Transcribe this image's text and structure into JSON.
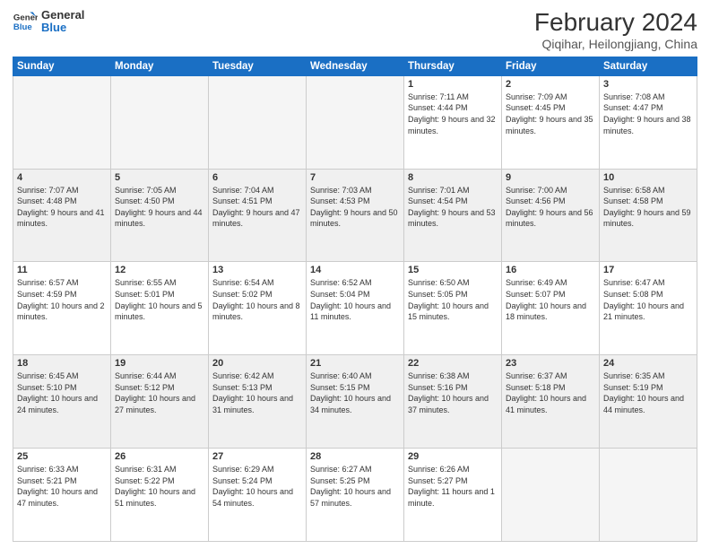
{
  "logo": {
    "line1": "General",
    "line2": "Blue"
  },
  "title": "February 2024",
  "location": "Qiqihar, Heilongjiang, China",
  "days_of_week": [
    "Sunday",
    "Monday",
    "Tuesday",
    "Wednesday",
    "Thursday",
    "Friday",
    "Saturday"
  ],
  "weeks": [
    [
      {
        "num": "",
        "empty": true
      },
      {
        "num": "",
        "empty": true
      },
      {
        "num": "",
        "empty": true
      },
      {
        "num": "",
        "empty": true
      },
      {
        "num": "1",
        "sunrise": "7:11 AM",
        "sunset": "4:44 PM",
        "daylight": "9 hours and 32 minutes."
      },
      {
        "num": "2",
        "sunrise": "7:09 AM",
        "sunset": "4:45 PM",
        "daylight": "9 hours and 35 minutes."
      },
      {
        "num": "3",
        "sunrise": "7:08 AM",
        "sunset": "4:47 PM",
        "daylight": "9 hours and 38 minutes."
      }
    ],
    [
      {
        "num": "4",
        "sunrise": "7:07 AM",
        "sunset": "4:48 PM",
        "daylight": "9 hours and 41 minutes."
      },
      {
        "num": "5",
        "sunrise": "7:05 AM",
        "sunset": "4:50 PM",
        "daylight": "9 hours and 44 minutes."
      },
      {
        "num": "6",
        "sunrise": "7:04 AM",
        "sunset": "4:51 PM",
        "daylight": "9 hours and 47 minutes."
      },
      {
        "num": "7",
        "sunrise": "7:03 AM",
        "sunset": "4:53 PM",
        "daylight": "9 hours and 50 minutes."
      },
      {
        "num": "8",
        "sunrise": "7:01 AM",
        "sunset": "4:54 PM",
        "daylight": "9 hours and 53 minutes."
      },
      {
        "num": "9",
        "sunrise": "7:00 AM",
        "sunset": "4:56 PM",
        "daylight": "9 hours and 56 minutes."
      },
      {
        "num": "10",
        "sunrise": "6:58 AM",
        "sunset": "4:58 PM",
        "daylight": "9 hours and 59 minutes."
      }
    ],
    [
      {
        "num": "11",
        "sunrise": "6:57 AM",
        "sunset": "4:59 PM",
        "daylight": "10 hours and 2 minutes."
      },
      {
        "num": "12",
        "sunrise": "6:55 AM",
        "sunset": "5:01 PM",
        "daylight": "10 hours and 5 minutes."
      },
      {
        "num": "13",
        "sunrise": "6:54 AM",
        "sunset": "5:02 PM",
        "daylight": "10 hours and 8 minutes."
      },
      {
        "num": "14",
        "sunrise": "6:52 AM",
        "sunset": "5:04 PM",
        "daylight": "10 hours and 11 minutes."
      },
      {
        "num": "15",
        "sunrise": "6:50 AM",
        "sunset": "5:05 PM",
        "daylight": "10 hours and 15 minutes."
      },
      {
        "num": "16",
        "sunrise": "6:49 AM",
        "sunset": "5:07 PM",
        "daylight": "10 hours and 18 minutes."
      },
      {
        "num": "17",
        "sunrise": "6:47 AM",
        "sunset": "5:08 PM",
        "daylight": "10 hours and 21 minutes."
      }
    ],
    [
      {
        "num": "18",
        "sunrise": "6:45 AM",
        "sunset": "5:10 PM",
        "daylight": "10 hours and 24 minutes."
      },
      {
        "num": "19",
        "sunrise": "6:44 AM",
        "sunset": "5:12 PM",
        "daylight": "10 hours and 27 minutes."
      },
      {
        "num": "20",
        "sunrise": "6:42 AM",
        "sunset": "5:13 PM",
        "daylight": "10 hours and 31 minutes."
      },
      {
        "num": "21",
        "sunrise": "6:40 AM",
        "sunset": "5:15 PM",
        "daylight": "10 hours and 34 minutes."
      },
      {
        "num": "22",
        "sunrise": "6:38 AM",
        "sunset": "5:16 PM",
        "daylight": "10 hours and 37 minutes."
      },
      {
        "num": "23",
        "sunrise": "6:37 AM",
        "sunset": "5:18 PM",
        "daylight": "10 hours and 41 minutes."
      },
      {
        "num": "24",
        "sunrise": "6:35 AM",
        "sunset": "5:19 PM",
        "daylight": "10 hours and 44 minutes."
      }
    ],
    [
      {
        "num": "25",
        "sunrise": "6:33 AM",
        "sunset": "5:21 PM",
        "daylight": "10 hours and 47 minutes."
      },
      {
        "num": "26",
        "sunrise": "6:31 AM",
        "sunset": "5:22 PM",
        "daylight": "10 hours and 51 minutes."
      },
      {
        "num": "27",
        "sunrise": "6:29 AM",
        "sunset": "5:24 PM",
        "daylight": "10 hours and 54 minutes."
      },
      {
        "num": "28",
        "sunrise": "6:27 AM",
        "sunset": "5:25 PM",
        "daylight": "10 hours and 57 minutes."
      },
      {
        "num": "29",
        "sunrise": "6:26 AM",
        "sunset": "5:27 PM",
        "daylight": "11 hours and 1 minute."
      },
      {
        "num": "",
        "empty": true
      },
      {
        "num": "",
        "empty": true
      }
    ]
  ],
  "labels": {
    "sunrise": "Sunrise:",
    "sunset": "Sunset:",
    "daylight": "Daylight:"
  }
}
